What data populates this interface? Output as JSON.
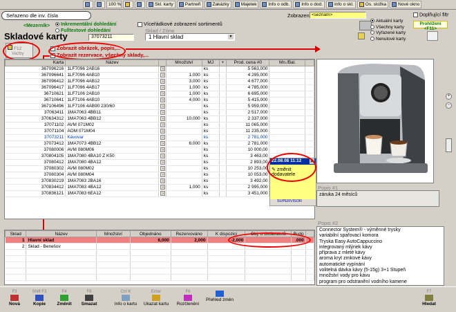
{
  "toolbar": {
    "zoom": "100 %",
    "items": [
      "Skl. karty",
      "Partneři",
      "Zakázky",
      "Majetek",
      "Info o odb.",
      "Info o dod.",
      "Info o skl.",
      "Os. složka",
      "Nové okno"
    ]
  },
  "sort": {
    "label": "Seřazeno dle inv. čísla"
  },
  "search": {
    "mezernik": "<Mezerník>",
    "incremental": "Inkrementální dohledání",
    "fulltext": "Fulltextové dohledání",
    "value": "37073211",
    "multirow": "Víceřádkové zobrazení sortimentů",
    "sklad_label": "Sklad / Zóna",
    "sklad_value": "1  Hlavní sklad"
  },
  "view": {
    "zobrazeni_label": "Zobrazení:",
    "zobrazeni_value": "<seznam>",
    "dopl_filter": "Doplňující filtr",
    "prohlizeni": "Prohlížení <F11>",
    "radios": [
      "Aktuální karty",
      "Všechny karty",
      "Vyřazené karty",
      "Nenulové karty"
    ]
  },
  "page_title": "Skladové karty",
  "vazby": {
    "key": "F12",
    "label": "Vazby"
  },
  "checks": {
    "show_img": "Zobrazit obrázek, popis,...",
    "show_res": "Zobrazit rezervace, všechny sklady,..."
  },
  "grid": {
    "headers": [
      "Karta",
      "Název",
      "",
      "Množství",
      "MJ",
      "+",
      "Prod. cena #0",
      "Mn./Bal."
    ],
    "rows": [
      [
        "367096216",
        "1LF7096 2AB16",
        "",
        "ks",
        "5 563,000",
        ""
      ],
      [
        "367096641",
        "1LF7096 4AB10",
        "1,000",
        "ks",
        "4 295,000",
        ""
      ],
      [
        "367096412",
        "1LF7096 4AB12",
        "3,000",
        "ks",
        "4 677,000",
        ""
      ],
      [
        "367096417",
        "1LF7096 4AB17",
        "1,000",
        "ks",
        "4 785,000",
        ""
      ],
      [
        "36710621",
        "1LF7106 2AB10",
        "1,000",
        "ks",
        "6 695,000",
        ""
      ],
      [
        "36710641",
        "1LF7106 4AB10",
        "4,000",
        "ks",
        "5 415,000",
        ""
      ],
      [
        "367106496",
        "1LF7106 4AB90  230/60",
        "",
        "ks",
        "5 959,000",
        ""
      ],
      [
        "37063411",
        "1MA7063 4BB11",
        "",
        "ks",
        "2 517,000",
        ""
      ],
      [
        "370634312",
        "1MA7063 4BB12",
        "10,000",
        "ks",
        "2 337,000",
        ""
      ],
      [
        "37071102",
        "AVM 071M02",
        "",
        "ks",
        "11 065,000",
        ""
      ],
      [
        "37071104",
        "AOM 071M04",
        "",
        "ks",
        "11 235,000",
        ""
      ],
      [
        "37073211",
        "Kávovar",
        "",
        "ks",
        "2 781,000",
        ""
      ],
      [
        "37073412",
        "1MA7073 4BB12",
        "6,000",
        "ks",
        "2 781,000",
        ""
      ],
      [
        "37080006",
        "AVM 080M06",
        "",
        "ks",
        "10 000,00",
        ""
      ],
      [
        "370804105",
        "1MA7080 4BA10 Z K50",
        "",
        "ks",
        "3 463,00",
        ""
      ],
      [
        "37080412",
        "1MA7080 4BA12",
        "",
        "ks",
        "2 893,00",
        ""
      ],
      [
        "37080302",
        "AVM 080M02",
        "",
        "ks",
        "10 253,00",
        ""
      ],
      [
        "37080304",
        "AVM 080M04",
        "",
        "ks",
        "10 053,00",
        ""
      ],
      [
        "370830219",
        "1MA7083 2BA16",
        "",
        "ks",
        "3 492,00",
        ""
      ],
      [
        "370834412",
        "1MA7083 4BA12",
        "1,000",
        "ks",
        "2 995,000",
        ""
      ],
      [
        "370836121",
        "1MA7083 6EA12",
        "",
        "ks",
        "3 451,000",
        ""
      ]
    ]
  },
  "note": {
    "date": "22.08.08 11:12",
    "text": "změnit dodavatele",
    "user": "SUPERVISOR"
  },
  "sklady": {
    "headers": [
      "Sklad",
      "Název",
      "Množství",
      "Objednáno",
      "Rezervováno",
      "K dispozici",
      "Obj. u dodavatelů",
      "Budo"
    ],
    "rows": [
      [
        "1",
        "Hlavní sklad",
        "",
        "6,000",
        "2,000",
        "-2,000",
        "",
        ".000"
      ],
      [
        "2",
        "Sklad - Benešov",
        "",
        "",
        "",
        "",
        "",
        ""
      ]
    ]
  },
  "popis1": {
    "label": "Popis #1",
    "text": "záruka 24 měsíců"
  },
  "popis2": {
    "label": "Popis #2",
    "lines": [
      "Connector System® - výměnné trysky",
      "variabilní spařovací komora",
      "Tryska Easy AutoCappuccino",
      "integrovaný mlýnek kávy",
      "příprava z mleté kávy",
      "aroma kryt zrnkové kávy",
      "automatické vypínání",
      "volitelná dávka kávy (5-15g)  3+1 Stupeň",
      "množství vody pro kávu",
      "program pro odstranění vodního kamene"
    ]
  },
  "buttons": [
    {
      "k": "F3",
      "l": "Nová"
    },
    {
      "k": "Shift F3",
      "l": "Kopie"
    },
    {
      "k": "F4",
      "l": "Změnit"
    },
    {
      "k": "F8",
      "l": "Smazat"
    },
    {
      "k": "Ctrl K",
      "l": "Info o kartu"
    },
    {
      "k": "Enter",
      "l": "Ukazat kartu"
    },
    {
      "k": "F6",
      "l": "Rozčlenění"
    },
    {
      "k": "",
      "l": "Přehled změn"
    },
    {
      "k": "F7",
      "l": "Hledat"
    }
  ],
  "colors": {
    "accent_red": "#dd0000",
    "note_yellow": "#ffff80",
    "selected_row": "#f08080",
    "link_green": "#0a7a0a"
  }
}
